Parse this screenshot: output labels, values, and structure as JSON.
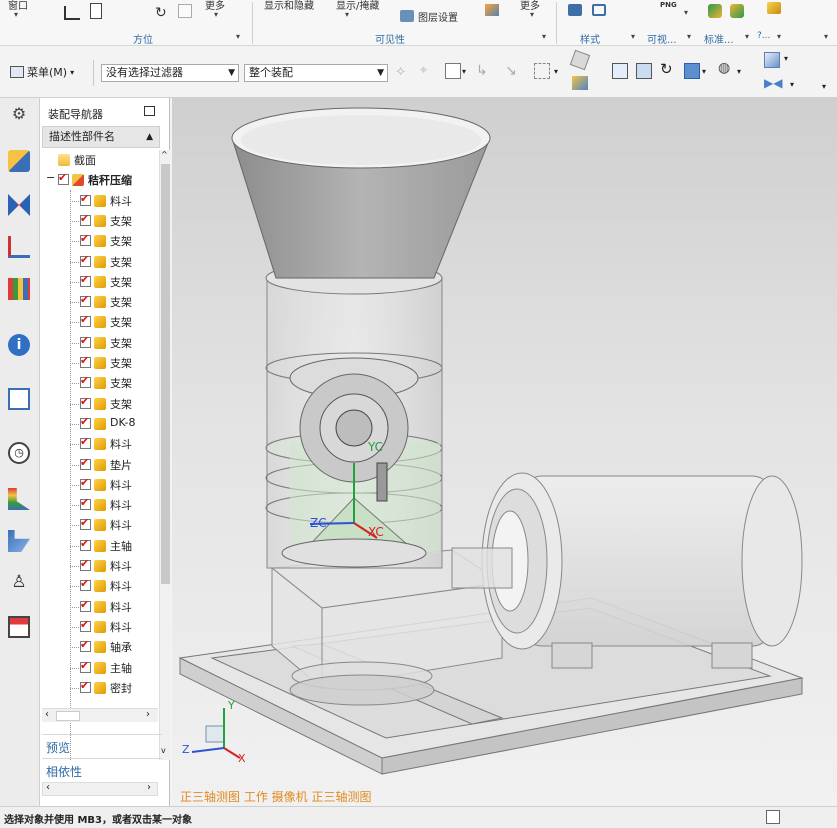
{
  "ribbon": {
    "partial_labels": [
      "窗口",
      "更多",
      "显示和隐藏",
      "显示/掩藏",
      "图层设置",
      "更多"
    ],
    "groups": [
      "方位",
      "可见性",
      "样式",
      "可视...",
      "标准..."
    ],
    "extra_small": [
      "PNG",
      "?..."
    ]
  },
  "toolbar": {
    "menu_label": "菜单(M)",
    "filter_value": "没有选择过滤器",
    "scope_value": "整个装配"
  },
  "navigator": {
    "title": "装配导航器",
    "column_header": "描述性部件名",
    "tree": [
      {
        "label": "截面",
        "level": 1,
        "kind": "folder"
      },
      {
        "label": "秸秆压缩",
        "level": 1,
        "kind": "assembly"
      },
      {
        "label": "料斗",
        "level": 2,
        "kind": "part"
      },
      {
        "label": "支架",
        "level": 2,
        "kind": "part"
      },
      {
        "label": "支架",
        "level": 2,
        "kind": "part"
      },
      {
        "label": "支架",
        "level": 2,
        "kind": "part"
      },
      {
        "label": "支架",
        "level": 2,
        "kind": "part"
      },
      {
        "label": "支架",
        "level": 2,
        "kind": "part"
      },
      {
        "label": "支架",
        "level": 2,
        "kind": "part"
      },
      {
        "label": "支架",
        "level": 2,
        "kind": "part"
      },
      {
        "label": "支架",
        "level": 2,
        "kind": "part"
      },
      {
        "label": "支架",
        "level": 2,
        "kind": "part"
      },
      {
        "label": "支架",
        "level": 2,
        "kind": "part"
      },
      {
        "label": "DK-8",
        "level": 2,
        "kind": "part"
      },
      {
        "label": "料斗",
        "level": 2,
        "kind": "part"
      },
      {
        "label": "垫片",
        "level": 2,
        "kind": "part"
      },
      {
        "label": "料斗",
        "level": 2,
        "kind": "part"
      },
      {
        "label": "料斗",
        "level": 2,
        "kind": "part"
      },
      {
        "label": "料斗",
        "level": 2,
        "kind": "part"
      },
      {
        "label": "主轴",
        "level": 2,
        "kind": "part"
      },
      {
        "label": "料斗",
        "level": 2,
        "kind": "part"
      },
      {
        "label": "料斗",
        "level": 2,
        "kind": "part"
      },
      {
        "label": "料斗",
        "level": 2,
        "kind": "part"
      },
      {
        "label": "料斗",
        "level": 2,
        "kind": "part"
      },
      {
        "label": "轴承",
        "level": 2,
        "kind": "part"
      },
      {
        "label": "主轴",
        "level": 2,
        "kind": "part"
      },
      {
        "label": "密封",
        "level": 2,
        "kind": "part"
      }
    ],
    "sections": [
      "预览",
      "相依性"
    ]
  },
  "viewport": {
    "axis_labels": {
      "yc": "YC",
      "xc": "XC",
      "zc": "ZC"
    },
    "triad_labels": {
      "x": "X",
      "y": "Y",
      "z": "Z"
    },
    "caption": "正三轴测图 工作 摄像机 正三轴测图"
  },
  "status": {
    "message": "选择对象并使用 MB3，或者双击某一对象"
  },
  "colors": {
    "accent_blue": "#2d6aa8",
    "caption_orange": "#e08a1e",
    "check_red": "#d11111",
    "axis_green": "#1fa33a",
    "axis_red": "#d22222",
    "axis_blue": "#2c52d6"
  }
}
